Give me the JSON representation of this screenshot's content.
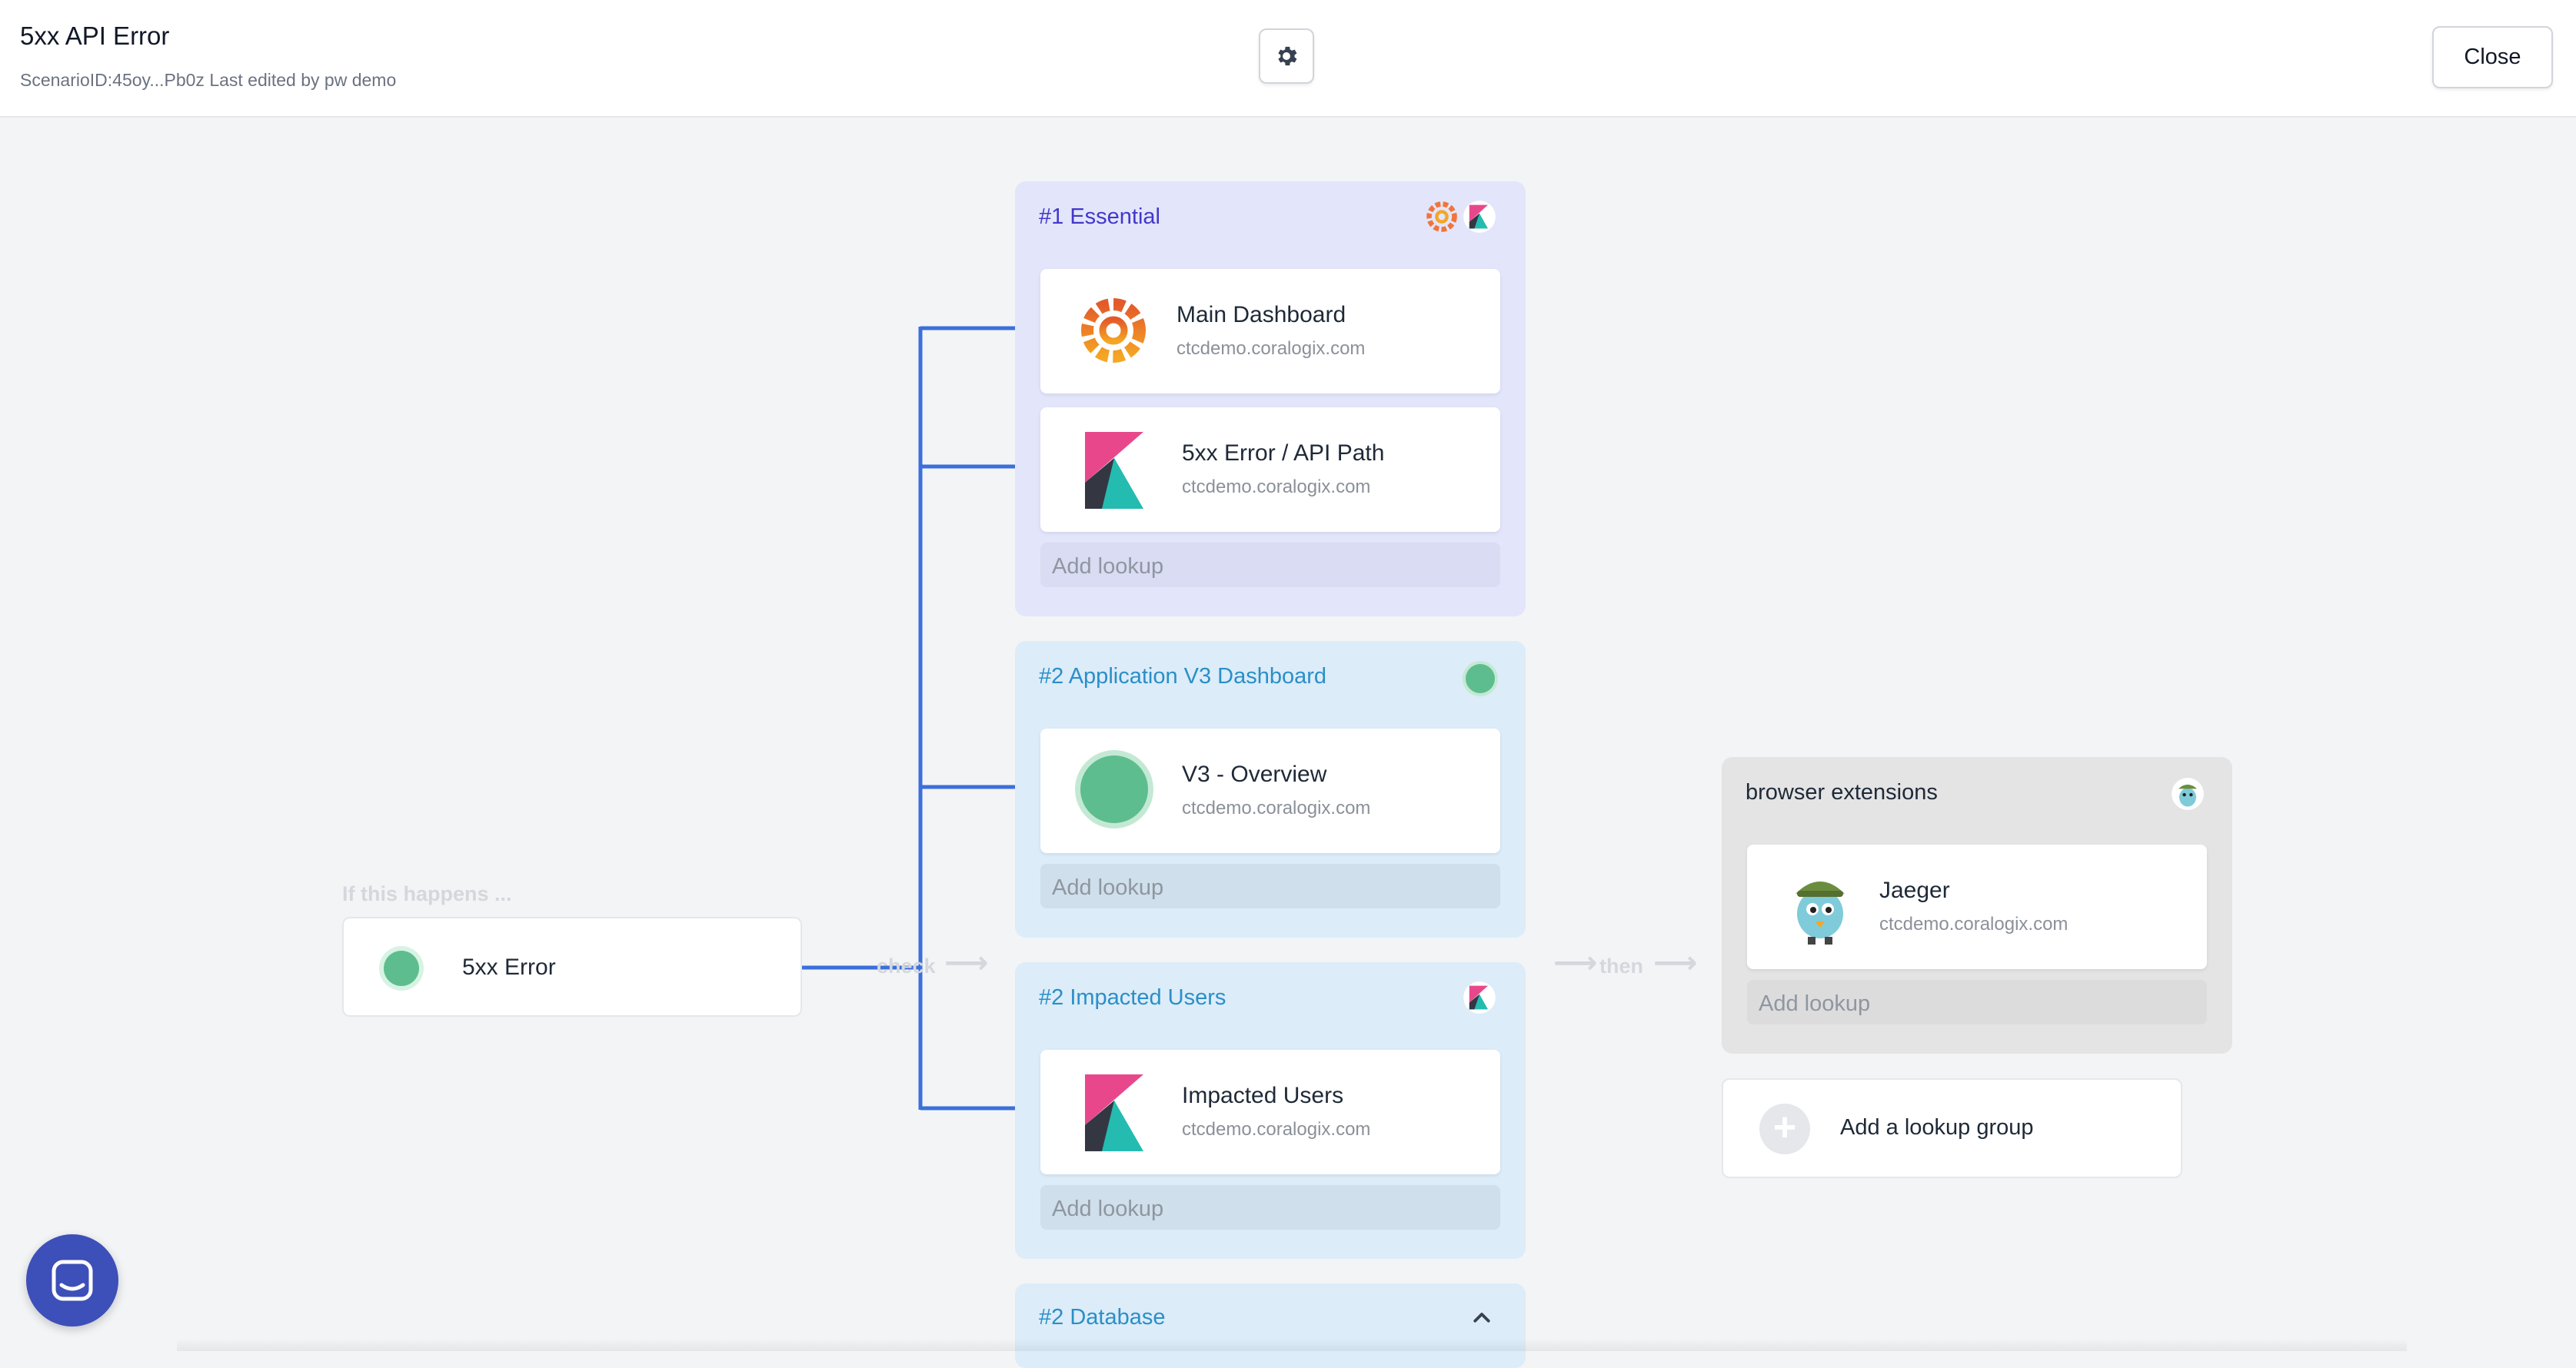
{
  "header": {
    "title": "5xx API Error",
    "subtitle": "ScenarioID:45oy...Pb0z Last edited by pw demo",
    "close_label": "Close",
    "settings_icon": "gear-icon"
  },
  "flow": {
    "if_label": "If this happens ...",
    "check_label": "check",
    "then_label": "then",
    "trigger": {
      "label": "5xx Error",
      "status_color": "#5ebd8e"
    }
  },
  "groups": [
    {
      "title": "#1 Essential",
      "icons": [
        "grafana-icon",
        "kibana-icon"
      ],
      "lookups": [
        {
          "name": "Main Dashboard",
          "host": "ctcdemo.coralogix.com",
          "icon": "grafana-icon"
        },
        {
          "name": "5xx Error / API Path",
          "host": "ctcdemo.coralogix.com",
          "icon": "kibana-icon"
        }
      ],
      "add_label": "Add lookup"
    },
    {
      "title": "#2 Application V3 Dashboard",
      "icons": [
        "green-dot-icon"
      ],
      "lookups": [
        {
          "name": "V3 - Overview",
          "host": "ctcdemo.coralogix.com",
          "icon": "green-dot-icon"
        }
      ],
      "add_label": "Add lookup"
    },
    {
      "title": "#2 Impacted Users",
      "icons": [
        "kibana-icon"
      ],
      "lookups": [
        {
          "name": "Impacted Users",
          "host": "ctcdemo.coralogix.com",
          "icon": "kibana-icon"
        }
      ],
      "add_label": "Add lookup"
    },
    {
      "title": "#2 Database",
      "icons": [
        "chevron-up-icon"
      ],
      "lookups": []
    }
  ],
  "then_groups": [
    {
      "title": "browser extensions",
      "icons": [
        "jaeger-icon"
      ],
      "lookups": [
        {
          "name": "Jaeger",
          "host": "ctcdemo.coralogix.com",
          "icon": "jaeger-icon"
        }
      ],
      "add_label": "Add lookup"
    }
  ],
  "add_group_label": "Add a lookup group",
  "colors": {
    "essential_bg": "#e3e5fb",
    "essential_title": "#4338ca",
    "group_bg": "#dcecf9",
    "group_title": "#2a8fc8",
    "connector": "#3b6fdc",
    "then_bg": "#e4e4e5"
  }
}
